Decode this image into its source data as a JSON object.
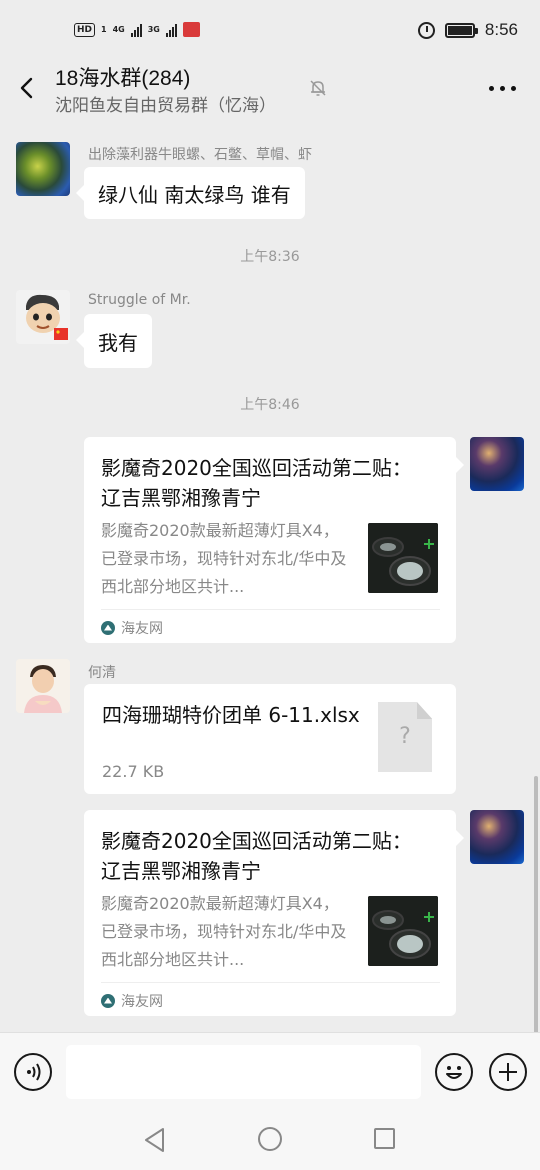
{
  "status_bar": {
    "hd": "HD",
    "hd_sub": "1",
    "net1": "4G",
    "net2": "3G",
    "time": "8:56"
  },
  "header": {
    "title": "18海水群(284)",
    "subtitle": "沈阳鱼友自由贸易群（忆海）"
  },
  "messages": [
    {
      "sender": "出除藻利器牛眼螺、石鳖、草帽、虾",
      "text": "绿八仙 南太绿鸟 谁有"
    },
    {
      "time": "上午8:36"
    },
    {
      "sender": "Struggle of Mr.",
      "text": "我有"
    },
    {
      "time": "上午8:46"
    },
    {
      "card_title": "影魔奇2020全国巡回活动第二贴：  辽吉黑鄂湘豫青宁",
      "card_desc": "影魔奇2020款最新超薄灯具X4，已登录市场，现特针对东北/华中及西北部分地区共计...",
      "card_source": "海友网"
    },
    {
      "sender": "何清",
      "file_name": "四海珊瑚特价团单 6-11.xlsx",
      "file_size": "22.7 KB",
      "file_icon": "?"
    },
    {
      "card_title": "影魔奇2020全国巡回活动第二贴：  辽吉黑鄂湘豫青宁",
      "card_desc": "影魔奇2020款最新超薄灯具X4，已登录市场，现特针对东北/华中及西北部分地区共计...",
      "card_source": "海友网"
    }
  ],
  "input": {
    "value": ""
  },
  "icons": {
    "back": "chevron-left-icon",
    "mute": "bell-off-icon",
    "more": "more-dots-icon",
    "voice": "voice-icon",
    "emoji": "emoji-icon",
    "plus": "plus-icon"
  }
}
